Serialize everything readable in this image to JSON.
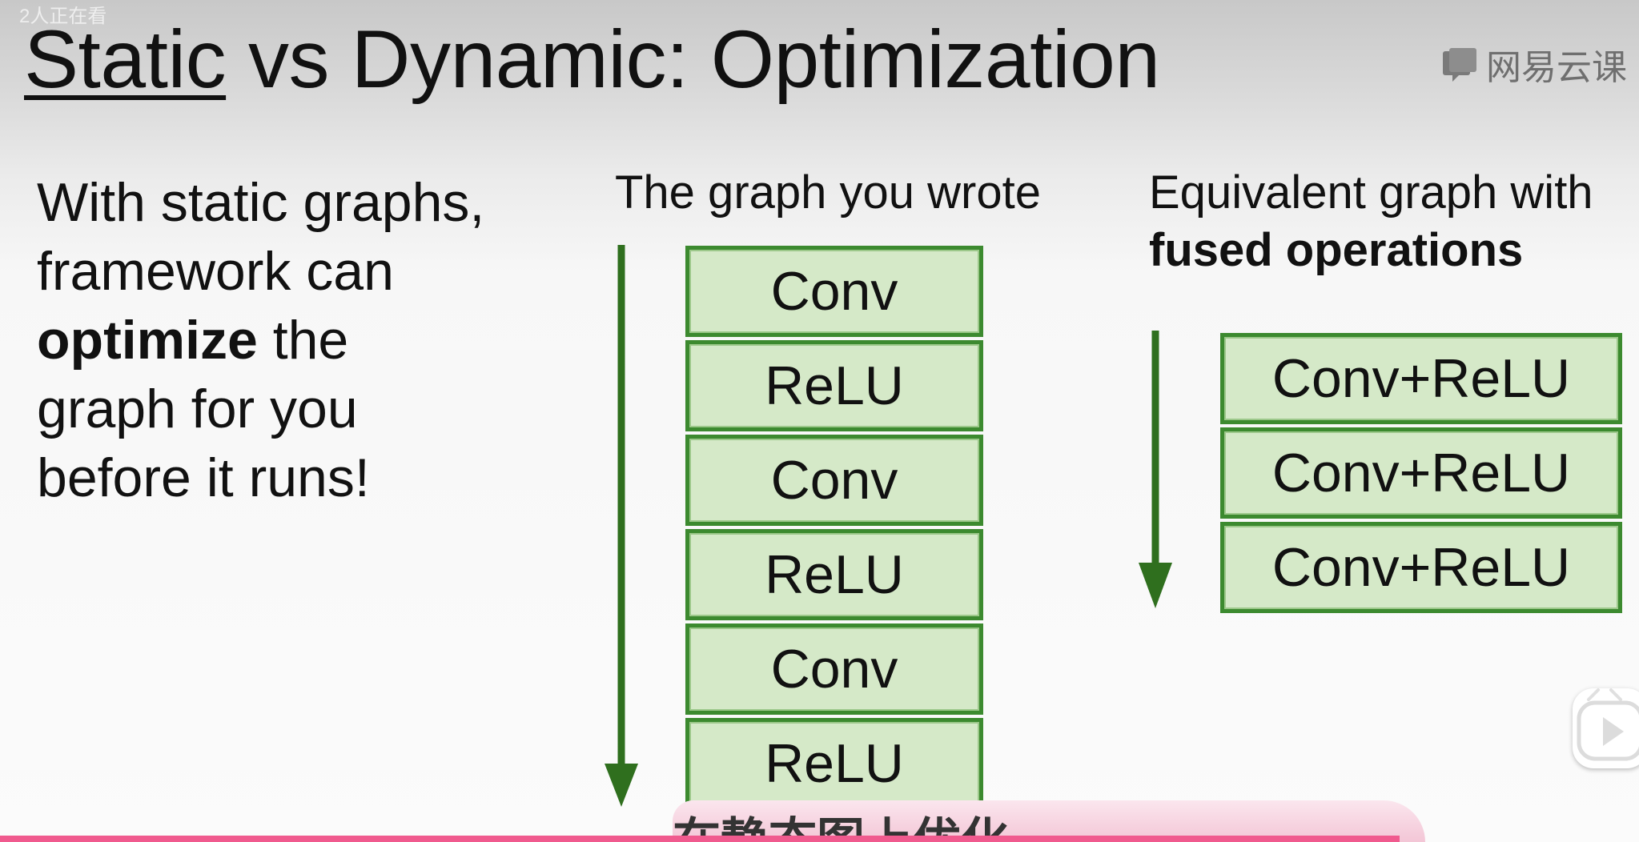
{
  "overlay": {
    "viewers": "2人正在看",
    "logo_text": "网易云课",
    "subtitle": "在静态图上优化"
  },
  "slide": {
    "title_underlined": "Static",
    "title_rest": " vs Dynamic: Optimization",
    "intro": {
      "line1": "With static graphs,",
      "line2": "framework can",
      "line3_bold": "optimize",
      "line3_rest": " the",
      "line4": "graph for you",
      "line5": "before it runs!"
    },
    "left_heading": "The graph you wrote",
    "left_nodes": [
      "Conv",
      "ReLU",
      "Conv",
      "ReLU",
      "Conv",
      "ReLU"
    ],
    "right_heading_line1": "Equivalent graph with",
    "right_heading_line2": "fused operations",
    "right_nodes": [
      "Conv+ReLU",
      "Conv+ReLU",
      "Conv+ReLU"
    ]
  },
  "player": {
    "progress": 0.854
  },
  "colors": {
    "node_fill": "#d5e9c8",
    "node_border": "#3c8a2f",
    "arrow": "#2f6f1e",
    "progress": "#f05a8e"
  }
}
